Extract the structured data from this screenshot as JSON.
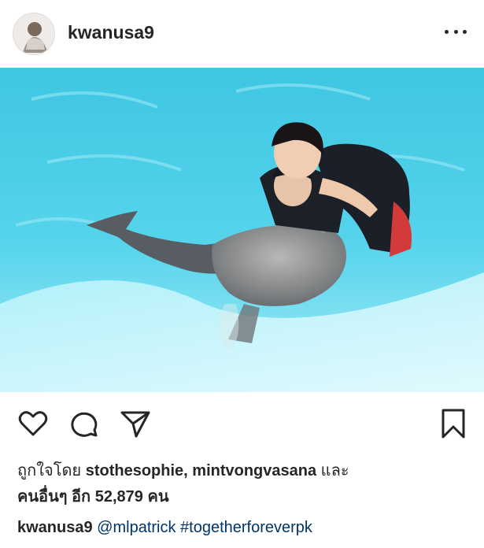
{
  "post": {
    "username": "kwanusa9",
    "photo_alt": "",
    "likes": {
      "prefix": "ถูกใจโดย",
      "users": "stothesophie, mintvongvasana",
      "joiner": "และ",
      "others_prefix": "คนอื่นๆ อีก",
      "others_count": "52,879",
      "others_suffix": "คน"
    },
    "caption": {
      "username": "kwanusa9",
      "mention": "@mlpatrick",
      "hashtag": "#togetherforeverpk"
    }
  },
  "icons": {
    "more": "more-options-icon",
    "like": "heart-icon",
    "comment": "comment-icon",
    "share": "send-icon",
    "save": "bookmark-icon"
  },
  "colors": {
    "text": "#262626",
    "link": "#003569",
    "water": "#4fd1e8",
    "border": "#dbdbdb"
  }
}
